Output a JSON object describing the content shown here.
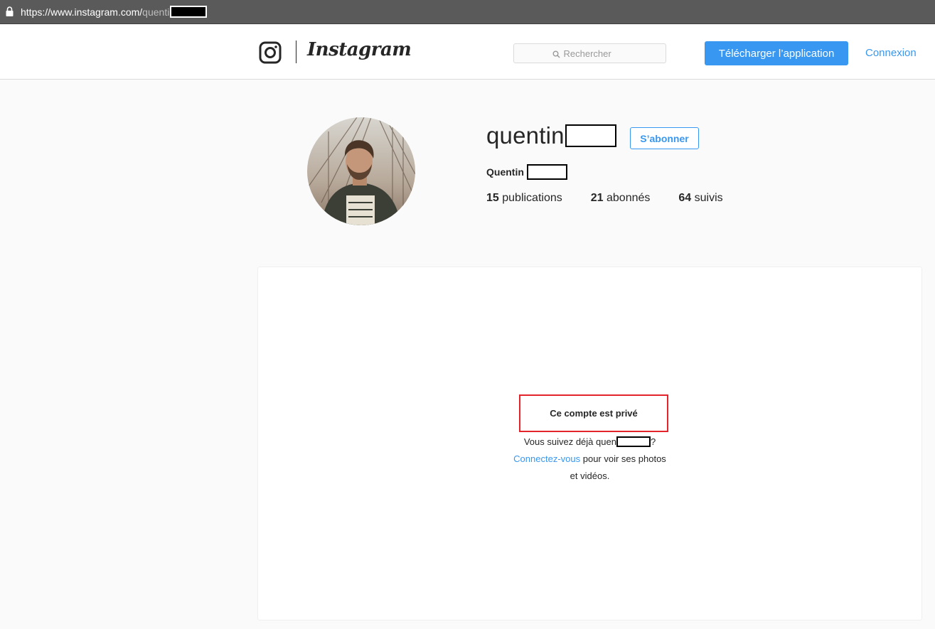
{
  "browser": {
    "url_base": "https://www.instagram.com/",
    "url_path": "quenti"
  },
  "header": {
    "wordmark": "Instagram",
    "search_placeholder": "Rechercher",
    "download_label": "Télécharger l’application",
    "login_label": "Connexion"
  },
  "profile": {
    "username": "quentin",
    "follow_label": "S’abonner",
    "full_name": "Quentin",
    "stats": {
      "posts_count": "15",
      "posts_label": "publications",
      "followers_count": "21",
      "followers_label": "abonnés",
      "following_count": "64",
      "following_label": "suivis"
    }
  },
  "private": {
    "title": "Ce compte est privé",
    "already_follow_prefix": "Vous suivez déjà quen",
    "already_follow_suffix": "?",
    "login_link": "Connectez-vous",
    "login_suffix": " pour voir ses photos",
    "line3": "et vidéos."
  },
  "colors": {
    "accent": "#3897f0",
    "highlight_border": "#e3242b",
    "background": "#fafafa"
  }
}
